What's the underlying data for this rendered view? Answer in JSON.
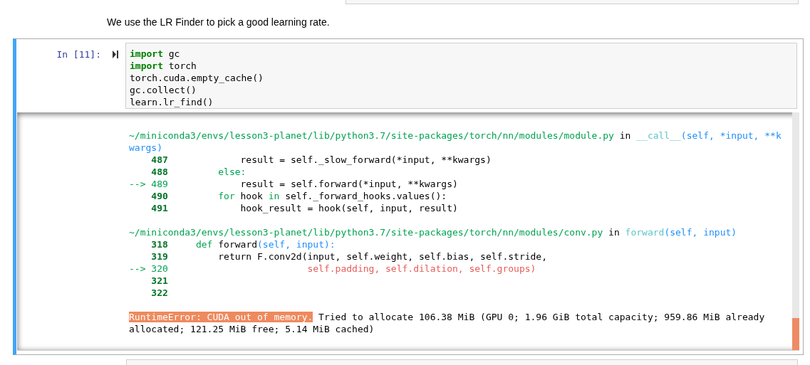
{
  "markdown": "We use the LR Finder to pick a good learning rate.",
  "cell": {
    "prompt": "In [11]:",
    "selected": true,
    "code": [
      [
        {
          "kind": "keyword",
          "text": "import"
        },
        {
          "kind": "plain",
          "text": " gc"
        }
      ],
      [
        {
          "kind": "keyword",
          "text": "import"
        },
        {
          "kind": "plain",
          "text": " torch"
        }
      ],
      [
        {
          "kind": "plain",
          "text": "torch.cuda.empty_cache()"
        }
      ],
      [
        {
          "kind": "plain",
          "text": "gc.collect()"
        }
      ],
      [
        {
          "kind": "plain",
          "text": "learn.lr_find()"
        }
      ]
    ],
    "output": {
      "frames": [
        {
          "header": [
            {
              "kind": "green",
              "text": "~/miniconda3/envs/lesson3-planet/lib/python3.7/site-packages/torch/nn/modules/module.py"
            },
            {
              "kind": "plain",
              "text": " in "
            },
            {
              "kind": "cyan",
              "text": "__call__"
            },
            {
              "kind": "blue",
              "text": "(self, *input, **kwargs)"
            }
          ],
          "lines": [
            [
              {
                "kind": "lineno",
                "text": "    487"
              },
              {
                "kind": "plain",
                "text": "             result = self._slow_forward(*input, **kwargs)"
              }
            ],
            [
              {
                "kind": "lineno",
                "text": "    488"
              },
              {
                "kind": "green",
                "text": "         else:"
              }
            ],
            [
              {
                "kind": "green",
                "text": "--> 489"
              },
              {
                "kind": "plain",
                "text": "             result = self.forward(*input, **kwargs)"
              }
            ],
            [
              {
                "kind": "lineno",
                "text": "    490"
              },
              {
                "kind": "green",
                "text": "         for"
              },
              {
                "kind": "plain",
                "text": " hook "
              },
              {
                "kind": "green",
                "text": "in"
              },
              {
                "kind": "plain",
                "text": " self._forward_hooks.values():"
              }
            ],
            [
              {
                "kind": "lineno",
                "text": "    491"
              },
              {
                "kind": "plain",
                "text": "             hook_result = hook(self, input, result)"
              }
            ]
          ]
        },
        {
          "header": [
            {
              "kind": "green",
              "text": "~/miniconda3/envs/lesson3-planet/lib/python3.7/site-packages/torch/nn/modules/conv.py"
            },
            {
              "kind": "plain",
              "text": " in "
            },
            {
              "kind": "cyan",
              "text": "forward"
            },
            {
              "kind": "blue",
              "text": "(self, input)"
            }
          ],
          "lines": [
            [
              {
                "kind": "lineno",
                "text": "    318"
              },
              {
                "kind": "green",
                "text": "     def"
              },
              {
                "kind": "plain",
                "text": " forward"
              },
              {
                "kind": "blue",
                "text": "(self, input):"
              }
            ],
            [
              {
                "kind": "lineno",
                "text": "    319"
              },
              {
                "kind": "plain",
                "text": "         return F.conv2d(input, self.weight, self.bias, self.stride,"
              }
            ],
            [
              {
                "kind": "green",
                "text": "--> 320"
              },
              {
                "kind": "red",
                "text": "                         self.padding, self.dilation, self.groups)"
              }
            ],
            [
              {
                "kind": "lineno",
                "text": "    321"
              }
            ],
            [
              {
                "kind": "lineno",
                "text": "    322"
              }
            ]
          ]
        }
      ],
      "error": {
        "name": "RuntimeError: CUDA out of memory.",
        "message": " Tried to allocate 106.38 MiB (GPU 0; 1.96 GiB total capacity; 959.86 MiB already allocated; 121.25 MiB free; 5.14 MiB cached)"
      }
    }
  }
}
